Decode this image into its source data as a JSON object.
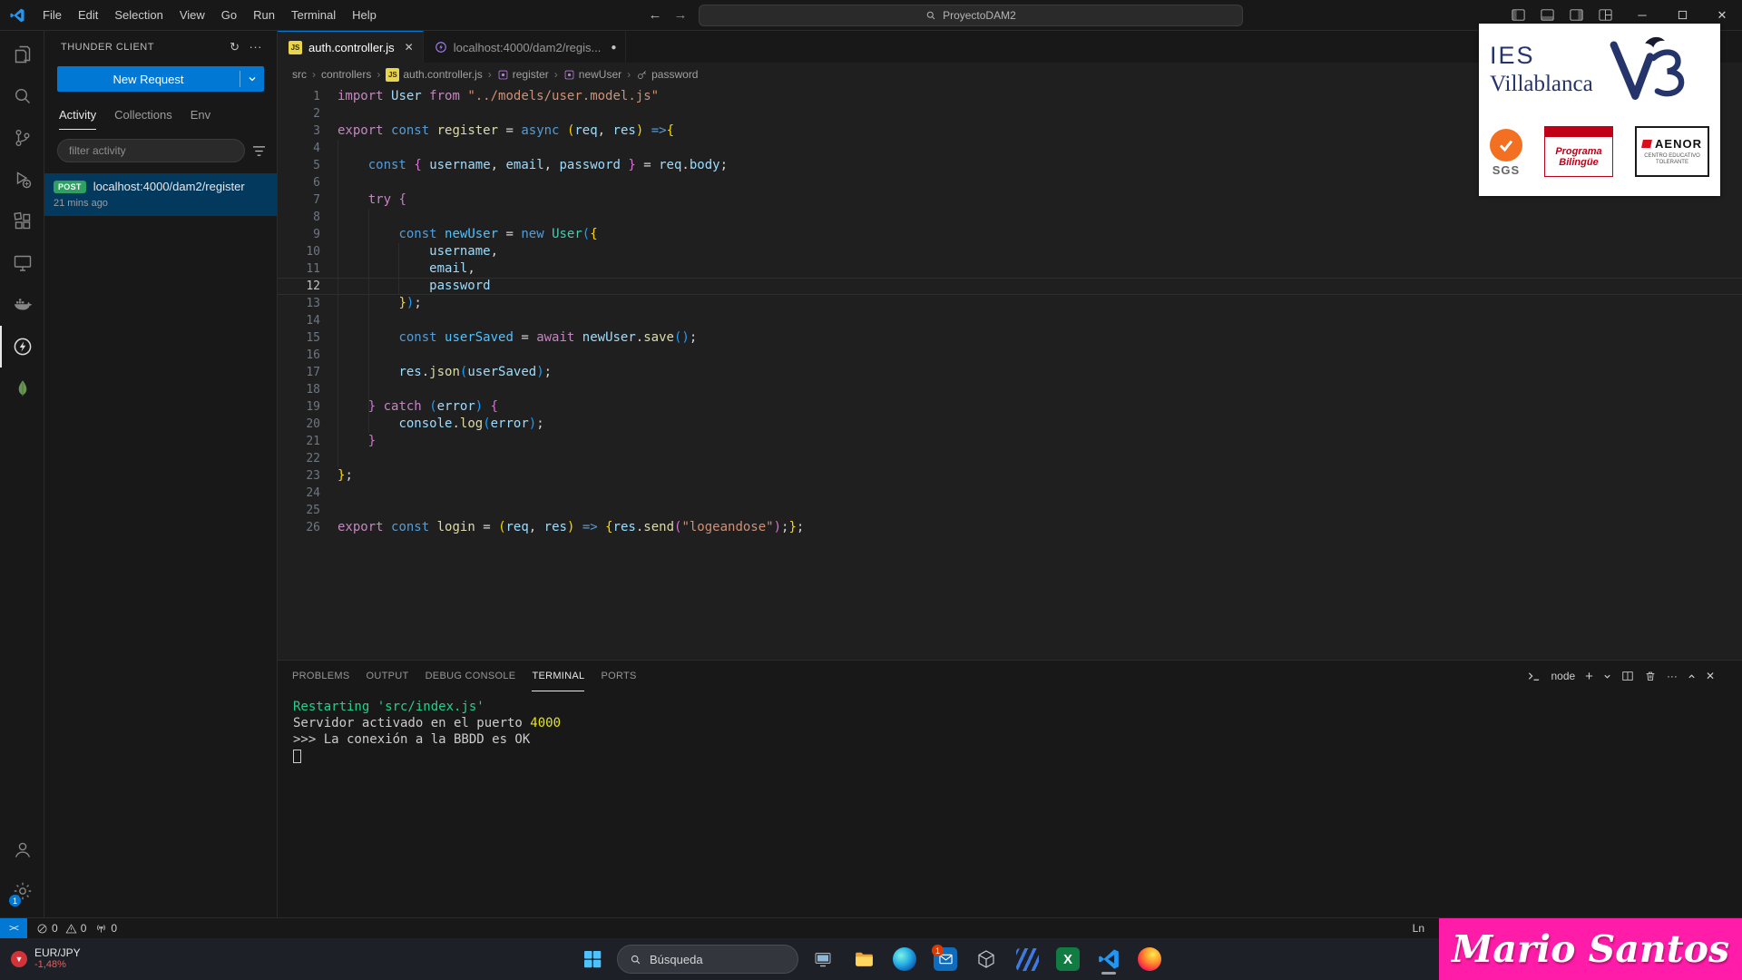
{
  "titlebar": {
    "menus": [
      "File",
      "Edit",
      "Selection",
      "View",
      "Go",
      "Run",
      "Terminal",
      "Help"
    ],
    "search_text": "ProyectoDAM2"
  },
  "activity_bar": {
    "items": [
      {
        "name": "explorer"
      },
      {
        "name": "search"
      },
      {
        "name": "source-control"
      },
      {
        "name": "run-debug"
      },
      {
        "name": "extensions"
      },
      {
        "name": "remote-explorer"
      },
      {
        "name": "docker"
      },
      {
        "name": "thunder-client",
        "active": true
      },
      {
        "name": "mongodb"
      }
    ],
    "bottom_items": [
      {
        "name": "account"
      },
      {
        "name": "settings",
        "badge": "1"
      }
    ]
  },
  "sidebar": {
    "title": "THUNDER CLIENT",
    "new_request_label": "New Request",
    "tabs": [
      {
        "label": "Activity",
        "active": true
      },
      {
        "label": "Collections",
        "active": false
      },
      {
        "label": "Env",
        "active": false
      }
    ],
    "filter_placeholder": "filter activity",
    "request": {
      "method": "POST",
      "url": "localhost:4000/dam2/register",
      "time": "21 mins ago"
    }
  },
  "editor": {
    "tabs": [
      {
        "label": "auth.controller.js",
        "icon": "js",
        "active": true,
        "dirty": false
      },
      {
        "label": "localhost:4000/dam2/regis...",
        "icon": "tc",
        "active": false,
        "dirty": true
      }
    ],
    "breadcrumbs": [
      {
        "label": "src",
        "icon": ""
      },
      {
        "label": "controllers",
        "icon": ""
      },
      {
        "label": "auth.controller.js",
        "icon": "js"
      },
      {
        "label": "register",
        "icon": "sym"
      },
      {
        "label": "newUser",
        "icon": "sym"
      },
      {
        "label": "password",
        "icon": "key"
      }
    ],
    "current_line": 12,
    "code": [
      [
        [
          "kw",
          "import"
        ],
        [
          "fg",
          " "
        ],
        [
          "var",
          "User"
        ],
        [
          "fg",
          " "
        ],
        [
          "kw",
          "from"
        ],
        [
          "fg",
          " "
        ],
        [
          "str",
          "\"../models/user.model.js\""
        ]
      ],
      [],
      [
        [
          "kw",
          "export"
        ],
        [
          "fg",
          " "
        ],
        [
          "st",
          "const"
        ],
        [
          "fg",
          " "
        ],
        [
          "fn",
          "register"
        ],
        [
          "fg",
          " = "
        ],
        [
          "st",
          "async"
        ],
        [
          "fg",
          " "
        ],
        [
          "b1",
          "("
        ],
        [
          "var",
          "req"
        ],
        [
          "fg",
          ", "
        ],
        [
          "var",
          "res"
        ],
        [
          "b1",
          ")"
        ],
        [
          "fg",
          " "
        ],
        [
          "st",
          "=>"
        ],
        [
          "b1",
          "{"
        ]
      ],
      [],
      [
        [
          "fg",
          "    "
        ],
        [
          "st",
          "const"
        ],
        [
          "fg",
          " "
        ],
        [
          "b2",
          "{"
        ],
        [
          "fg",
          " "
        ],
        [
          "var",
          "username"
        ],
        [
          "fg",
          ", "
        ],
        [
          "var",
          "email"
        ],
        [
          "fg",
          ", "
        ],
        [
          "var",
          "password"
        ],
        [
          "fg",
          " "
        ],
        [
          "b2",
          "}"
        ],
        [
          "fg",
          " = "
        ],
        [
          "var",
          "req"
        ],
        [
          "fg",
          "."
        ],
        [
          "var",
          "body"
        ],
        [
          "fg",
          ";"
        ]
      ],
      [],
      [
        [
          "fg",
          "    "
        ],
        [
          "kw",
          "try"
        ],
        [
          "fg",
          " "
        ],
        [
          "b2",
          "{"
        ]
      ],
      [],
      [
        [
          "fg",
          "        "
        ],
        [
          "st",
          "const"
        ],
        [
          "fg",
          " "
        ],
        [
          "cv",
          "newUser"
        ],
        [
          "fg",
          " = "
        ],
        [
          "st",
          "new"
        ],
        [
          "fg",
          " "
        ],
        [
          "cls",
          "User"
        ],
        [
          "b3",
          "("
        ],
        [
          "b1",
          "{"
        ]
      ],
      [
        [
          "fg",
          "            "
        ],
        [
          "var",
          "username"
        ],
        [
          "fg",
          ","
        ]
      ],
      [
        [
          "fg",
          "            "
        ],
        [
          "var",
          "email"
        ],
        [
          "fg",
          ","
        ]
      ],
      [
        [
          "fg",
          "            "
        ],
        [
          "var",
          "password"
        ]
      ],
      [
        [
          "fg",
          "        "
        ],
        [
          "b1",
          "}"
        ],
        [
          "b3",
          ")"
        ],
        [
          "fg",
          ";"
        ]
      ],
      [],
      [
        [
          "fg",
          "        "
        ],
        [
          "st",
          "const"
        ],
        [
          "fg",
          " "
        ],
        [
          "cv",
          "userSaved"
        ],
        [
          "fg",
          " = "
        ],
        [
          "kw",
          "await"
        ],
        [
          "fg",
          " "
        ],
        [
          "var",
          "newUser"
        ],
        [
          "fg",
          "."
        ],
        [
          "fn",
          "save"
        ],
        [
          "b3",
          "()"
        ],
        [
          "fg",
          ";"
        ]
      ],
      [],
      [
        [
          "fg",
          "        "
        ],
        [
          "var",
          "res"
        ],
        [
          "fg",
          "."
        ],
        [
          "fn",
          "json"
        ],
        [
          "b3",
          "("
        ],
        [
          "var",
          "userSaved"
        ],
        [
          "b3",
          ")"
        ],
        [
          "fg",
          ";"
        ]
      ],
      [],
      [
        [
          "fg",
          "    "
        ],
        [
          "b2",
          "}"
        ],
        [
          "fg",
          " "
        ],
        [
          "kw",
          "catch"
        ],
        [
          "fg",
          " "
        ],
        [
          "b3",
          "("
        ],
        [
          "var",
          "error"
        ],
        [
          "b3",
          ")"
        ],
        [
          "fg",
          " "
        ],
        [
          "b2",
          "{"
        ]
      ],
      [
        [
          "fg",
          "        "
        ],
        [
          "var",
          "console"
        ],
        [
          "fg",
          "."
        ],
        [
          "fn",
          "log"
        ],
        [
          "b3",
          "("
        ],
        [
          "var",
          "error"
        ],
        [
          "b3",
          ")"
        ],
        [
          "fg",
          ";"
        ]
      ],
      [
        [
          "fg",
          "    "
        ],
        [
          "b2",
          "}"
        ]
      ],
      [],
      [
        [
          "b1",
          "}"
        ],
        [
          "fg",
          ";"
        ]
      ],
      [],
      [],
      [
        [
          "kw",
          "export"
        ],
        [
          "fg",
          " "
        ],
        [
          "st",
          "const"
        ],
        [
          "fg",
          " "
        ],
        [
          "fn",
          "login"
        ],
        [
          "fg",
          " = "
        ],
        [
          "b1",
          "("
        ],
        [
          "var",
          "req"
        ],
        [
          "fg",
          ", "
        ],
        [
          "var",
          "res"
        ],
        [
          "b1",
          ")"
        ],
        [
          "fg",
          " "
        ],
        [
          "st",
          "=>"
        ],
        [
          "fg",
          " "
        ],
        [
          "b1",
          "{"
        ],
        [
          "var",
          "res"
        ],
        [
          "fg",
          "."
        ],
        [
          "fn",
          "send"
        ],
        [
          "b2",
          "("
        ],
        [
          "str",
          "\"logeandose\""
        ],
        [
          "b2",
          ")"
        ],
        [
          "fg",
          ";"
        ],
        [
          "b1",
          "}"
        ],
        [
          "fg",
          ";"
        ]
      ]
    ]
  },
  "panel": {
    "tabs": [
      {
        "label": "PROBLEMS",
        "active": false
      },
      {
        "label": "OUTPUT",
        "active": false
      },
      {
        "label": "DEBUG CONSOLE",
        "active": false
      },
      {
        "label": "TERMINAL",
        "active": true
      },
      {
        "label": "PORTS",
        "active": false
      }
    ],
    "shell_label": "node",
    "terminal_lines": [
      [
        [
          "green",
          "Restarting 'src/index.js'"
        ]
      ],
      [
        [
          "fg",
          "Servidor activado en el puerto "
        ],
        [
          "yellow",
          "4000"
        ]
      ],
      [
        [
          "fg",
          ">>> La conexión a la BBDD es OK"
        ]
      ]
    ]
  },
  "status_bar": {
    "remote_glyph": "><",
    "errors": "0",
    "warnings": "0",
    "ports": "0",
    "ln_label": "Ln"
  },
  "taskbar": {
    "widget": {
      "symbol": "EUR/JPY",
      "change": "-1,48%",
      "badge": "1"
    },
    "search_text": "Búsqueda",
    "icons": [
      {
        "name": "computer"
      },
      {
        "name": "file-explorer"
      },
      {
        "name": "edge"
      },
      {
        "name": "mail",
        "badge": "1"
      },
      {
        "name": "dev-cube"
      },
      {
        "name": "stripes-app"
      },
      {
        "name": "excel"
      },
      {
        "name": "vscode",
        "running": true
      },
      {
        "name": "firefox"
      }
    ]
  },
  "overlays": {
    "school": {
      "ies": "IES",
      "name": "Villablanca",
      "sgs": "SGS",
      "bilingue_line1": "Programa",
      "bilingue_line2": "Bilingüe",
      "aenor": "AENOR",
      "aenor_sub1": "CENTRO EDUCATIVO",
      "aenor_sub2": "TOLERANTE"
    },
    "watermark": "Mario Santos"
  },
  "colors": {
    "accent": "#0078d4",
    "selection_bg": "#04395e",
    "post_green": "#2ea062",
    "watermark_pink": "#ff1ca8",
    "syntax": {
      "kw": "#C586C0",
      "st": "#569CD6",
      "var": "#9CDCFE",
      "cv": "#4FC1FF",
      "cls": "#4EC9B0",
      "fn": "#DCDCAA",
      "str": "#CE9178",
      "fg": "#D4D4D4",
      "b1": "#FFD700",
      "b2": "#DA70D6",
      "b3": "#179FFF"
    },
    "terminal": {
      "tgreen": "#23D18B",
      "tyellow": "#E5E510"
    }
  }
}
